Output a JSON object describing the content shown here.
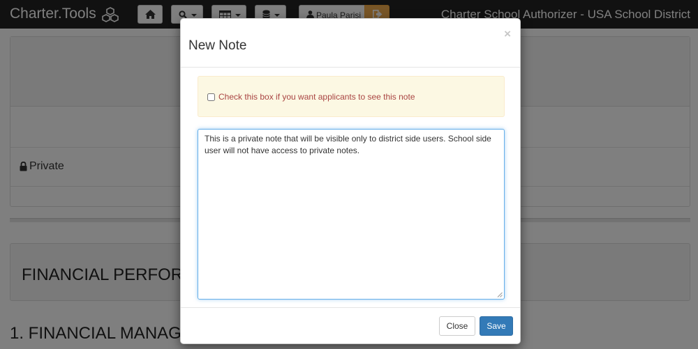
{
  "app": {
    "brand": "Charter.Tools",
    "title": "Charter School Authorizer - USA School District"
  },
  "navbar": {
    "icons": [
      "home-icon",
      "search-icon",
      "table-icon",
      "database-icon",
      "user-icon",
      "logout-icon"
    ],
    "user_name": "Paula Parisi",
    "logout_color": "#f0ad4e"
  },
  "page": {
    "private_label": "Private",
    "financial_heading": "FINANCIAL PERFOR",
    "financial_subheading": "1. FINANCIAL MANAG"
  },
  "modal": {
    "title": "New Note",
    "close_symbol": "×",
    "checkbox_label": "Check this box if you want applicants to see this note",
    "checkbox_checked": false,
    "note_text": "This is a private note that will be visible only to district side users. School side user will not have access to private notes.",
    "close_button": "Close",
    "save_button": "Save",
    "accent_color": "#337ab7",
    "warning_bg": "#fcf8e3",
    "warning_text_color": "#a94442"
  }
}
